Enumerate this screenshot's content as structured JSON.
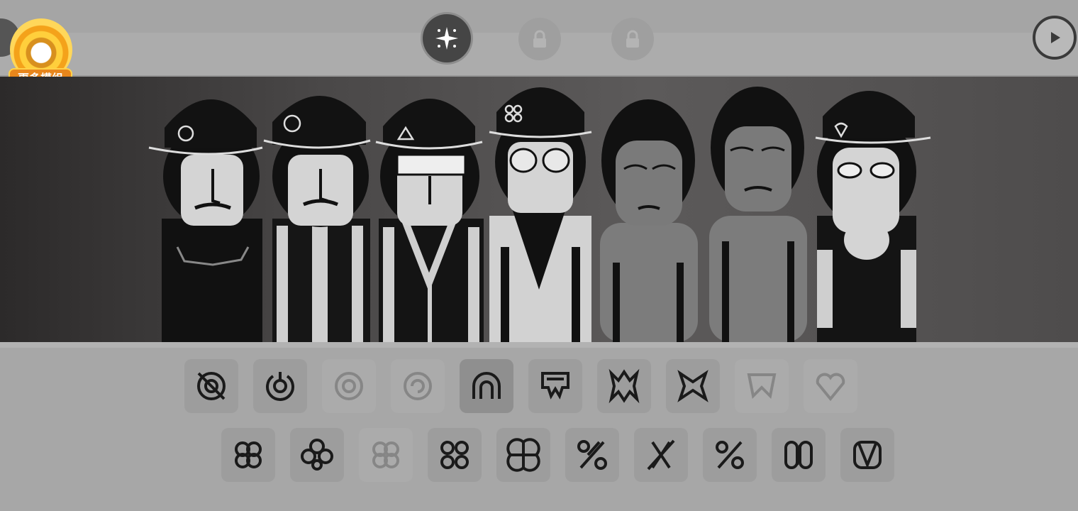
{
  "mods_badge": {
    "label": "更多模组"
  },
  "top_bar": {
    "mode_buttons": [
      {
        "name": "sparkle-icon",
        "state": "active"
      },
      {
        "name": "lock-icon",
        "state": "locked"
      },
      {
        "name": "lock-icon",
        "state": "locked"
      }
    ],
    "play_button": "play-icon"
  },
  "characters": [
    {
      "name": "character-1",
      "hat_icon": "ring-icon",
      "state": "active"
    },
    {
      "name": "character-2",
      "hat_icon": "target-icon",
      "state": "active"
    },
    {
      "name": "character-3",
      "hat_icon": "triangle-icon",
      "state": "active"
    },
    {
      "name": "character-4",
      "hat_icon": "clover-icon",
      "state": "active"
    },
    {
      "name": "character-5",
      "hat_icon": "none",
      "state": "idle"
    },
    {
      "name": "character-6",
      "hat_icon": "none",
      "state": "idle"
    },
    {
      "name": "character-7",
      "hat_icon": "heart-icon",
      "state": "active"
    }
  ],
  "sound_icons_row1": [
    {
      "name": "crossed-circle-sound-icon",
      "state": "available"
    },
    {
      "name": "power-circle-sound-icon",
      "state": "available"
    },
    {
      "name": "ring-sound-icon",
      "state": "used"
    },
    {
      "name": "spiral-sound-icon",
      "state": "used"
    },
    {
      "name": "arch-sound-icon",
      "state": "available"
    },
    {
      "name": "flag-sound-icon",
      "state": "available"
    },
    {
      "name": "spike-sound-icon",
      "state": "available"
    },
    {
      "name": "bowtie-sound-icon",
      "state": "available"
    },
    {
      "name": "crown-sound-icon",
      "state": "used"
    },
    {
      "name": "heart-sound-icon",
      "state": "used"
    }
  ],
  "sound_icons_row2": [
    {
      "name": "clover-sound-icon",
      "state": "available"
    },
    {
      "name": "clover-alt-sound-icon",
      "state": "available"
    },
    {
      "name": "clover-faded-sound-icon",
      "state": "used"
    },
    {
      "name": "quad-sound-icon",
      "state": "available"
    },
    {
      "name": "quad-alt-sound-icon",
      "state": "available"
    },
    {
      "name": "percent-sound-icon",
      "state": "available"
    },
    {
      "name": "percent-alt-sound-icon",
      "state": "available"
    },
    {
      "name": "percent-slash-sound-icon",
      "state": "available"
    },
    {
      "name": "double-o-sound-icon",
      "state": "available"
    },
    {
      "name": "double-v-sound-icon",
      "state": "available"
    }
  ],
  "colors": {
    "background": "#a7a7a7",
    "stage": "#4a4848",
    "badge": "#e8861c",
    "icon_stroke": "#1a1a1a"
  }
}
